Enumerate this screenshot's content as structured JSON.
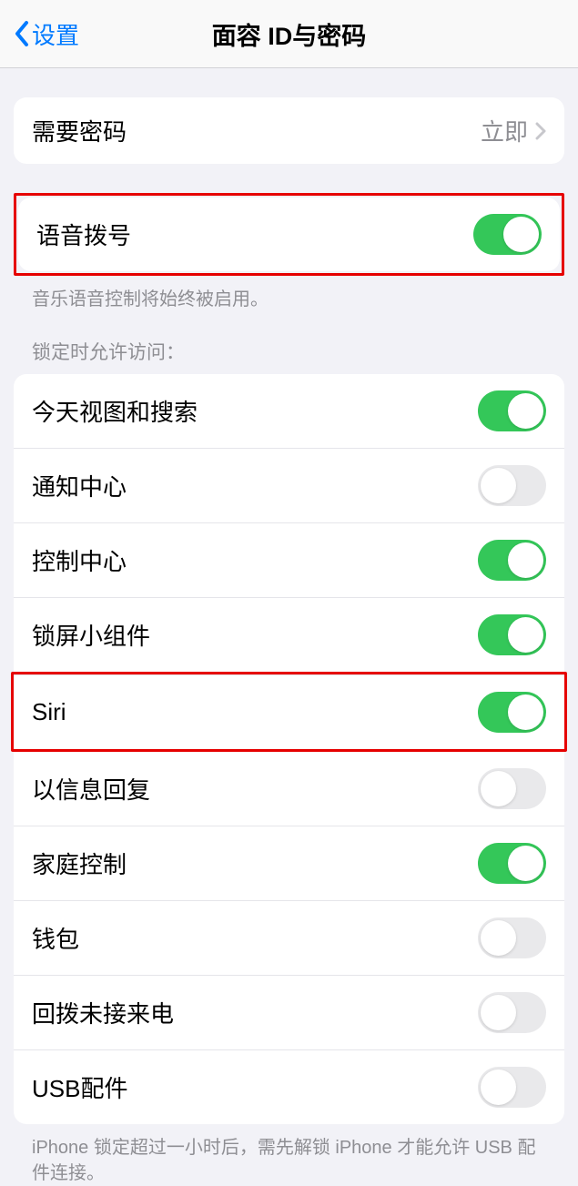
{
  "header": {
    "back_label": "设置",
    "title": "面容 ID与密码"
  },
  "require_passcode": {
    "label": "需要密码",
    "value": "立即"
  },
  "voice_dial": {
    "label": "语音拨号",
    "on": true,
    "footer": "音乐语音控制将始终被启用。"
  },
  "locked_access": {
    "header": "锁定时允许访问：",
    "items": [
      {
        "label": "今天视图和搜索",
        "on": true
      },
      {
        "label": "通知中心",
        "on": false
      },
      {
        "label": "控制中心",
        "on": true
      },
      {
        "label": "锁屏小组件",
        "on": true
      },
      {
        "label": "Siri",
        "on": true,
        "highlight": true
      },
      {
        "label": "以信息回复",
        "on": false
      },
      {
        "label": "家庭控制",
        "on": true
      },
      {
        "label": "钱包",
        "on": false
      },
      {
        "label": "回拨未接来电",
        "on": false
      },
      {
        "label": "USB配件",
        "on": false
      }
    ],
    "footer": "iPhone 锁定超过一小时后，需先解锁 iPhone 才能允许 USB 配件连接。"
  }
}
